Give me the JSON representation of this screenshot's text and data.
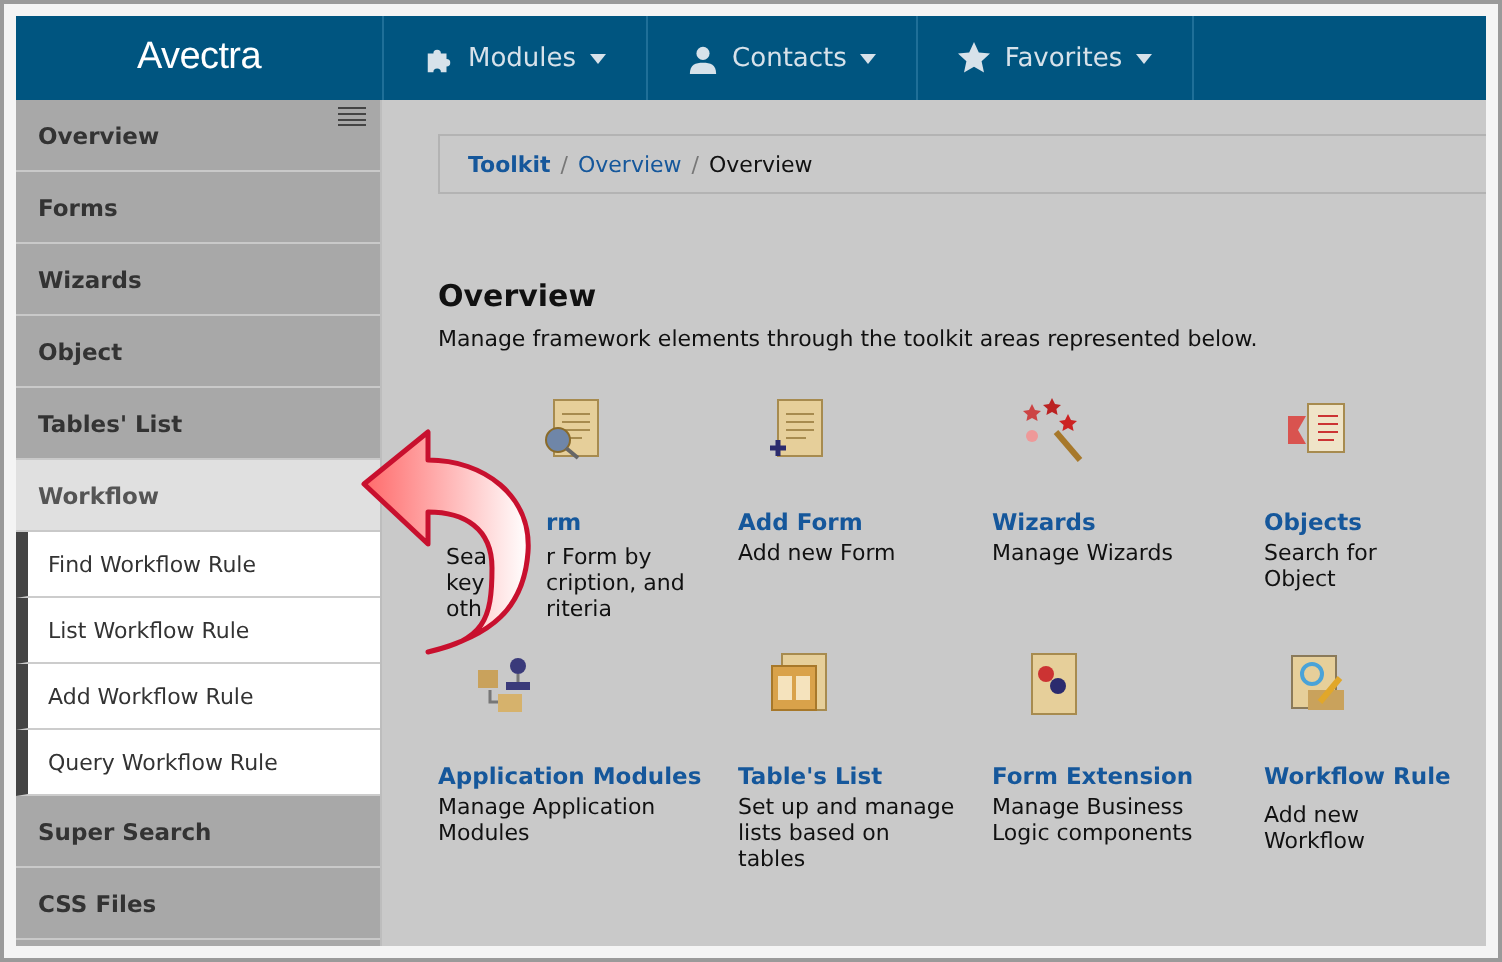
{
  "header": {
    "logo": "Avectra",
    "nav": [
      {
        "label": "Modules"
      },
      {
        "label": "Contacts"
      },
      {
        "label": "Favorites"
      }
    ]
  },
  "sidebar": {
    "items": [
      {
        "label": "Overview",
        "selected": false
      },
      {
        "label": "Forms",
        "selected": false
      },
      {
        "label": "Wizards",
        "selected": false
      },
      {
        "label": "Object",
        "selected": false
      },
      {
        "label": "Tables' List",
        "selected": false
      },
      {
        "label": "Workflow",
        "selected": true,
        "children": [
          {
            "label": "Find Workflow Rule"
          },
          {
            "label": "List Workflow Rule"
          },
          {
            "label": "Add Workflow Rule"
          },
          {
            "label": "Query Workflow Rule"
          }
        ]
      },
      {
        "label": "Super Search",
        "selected": false
      },
      {
        "label": "CSS Files",
        "selected": false
      }
    ]
  },
  "breadcrumb": [
    {
      "label": "Toolkit",
      "kind": "root"
    },
    {
      "label": "/",
      "kind": "separator"
    },
    {
      "label": "Overview",
      "kind": "link"
    },
    {
      "label": "/",
      "kind": "separator"
    },
    {
      "label": "Overview",
      "kind": "current"
    }
  ],
  "heading": "Overview",
  "intro": "Manage framework elements through the toolkit areas represented below.",
  "tiles": [
    {
      "kind": "covered",
      "title": "rm",
      "lines": [
        [
          "Sea",
          "r Form by"
        ],
        [
          "key",
          "cription, and"
        ],
        [
          "oth",
          "riteria"
        ]
      ]
    },
    {
      "kind": "plain",
      "title": "Add Form",
      "description": "Add new Form"
    },
    {
      "kind": "plain",
      "title": "Wizards",
      "description": "Manage Wizards"
    },
    {
      "kind": "plain",
      "title": "Objects",
      "description": "Search for Object"
    },
    {
      "kind": "plain",
      "title": "Application Modules",
      "description": "Manage Application Modules"
    },
    {
      "kind": "plain",
      "title": "Table's List",
      "description": "Set up and manage lists based on tables"
    },
    {
      "kind": "plain",
      "title": "Form Extension",
      "description": "Manage Business Logic components"
    },
    {
      "kind": "plain",
      "title": "Workflow Rule",
      "description": "Add new Workflow"
    }
  ]
}
